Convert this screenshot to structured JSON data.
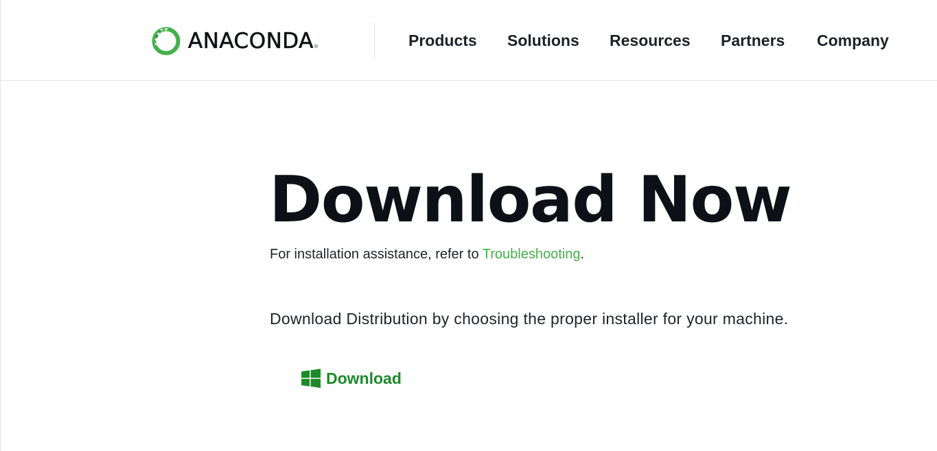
{
  "brand": {
    "name": "ANACONDA",
    "registered_mark": "®",
    "logo_icon": "anaconda-ring-icon",
    "accent_color": "#43b049"
  },
  "nav": {
    "items": [
      {
        "label": "Products"
      },
      {
        "label": "Solutions"
      },
      {
        "label": "Resources"
      },
      {
        "label": "Partners"
      },
      {
        "label": "Company"
      }
    ]
  },
  "hero": {
    "title": "Download Now",
    "assist_prefix": "For installation assistance, refer to ",
    "assist_link": "Troubleshooting",
    "assist_suffix": ".",
    "distribution_text": "Download Distribution by choosing the proper installer for your machine."
  },
  "download": {
    "label": "Download",
    "icon": "windows-icon",
    "color": "#1d8a2a"
  }
}
